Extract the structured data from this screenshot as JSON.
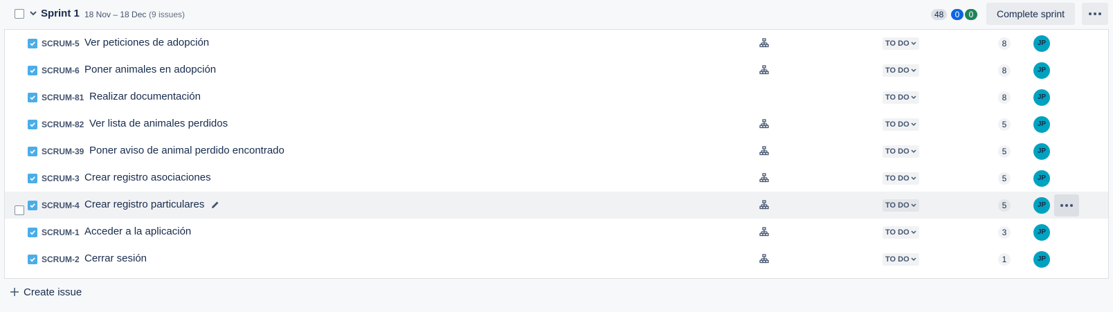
{
  "sprint": {
    "name": "Sprint 1",
    "dates": "18 Nov – 18 Dec",
    "issue_count": "(9 issues)",
    "points_total": "48",
    "points_in_progress": "0",
    "points_done": "0",
    "complete_label": "Complete sprint"
  },
  "issues": [
    {
      "key": "SCRUM-5",
      "summary": "Ver peticiones de adopción",
      "status": "TO DO",
      "points": "8",
      "assignee": "JP",
      "has_children": true
    },
    {
      "key": "SCRUM-6",
      "summary": "Poner animales en adopción",
      "status": "TO DO",
      "points": "8",
      "assignee": "JP",
      "has_children": true
    },
    {
      "key": "SCRUM-81",
      "summary": "Realizar documentación",
      "status": "TO DO",
      "points": "8",
      "assignee": "JP",
      "has_children": false
    },
    {
      "key": "SCRUM-82",
      "summary": "Ver lista de animales perdidos",
      "status": "TO DO",
      "points": "5",
      "assignee": "JP",
      "has_children": true
    },
    {
      "key": "SCRUM-39",
      "summary": "Poner aviso de animal perdido encontrado",
      "status": "TO DO",
      "points": "5",
      "assignee": "JP",
      "has_children": true
    },
    {
      "key": "SCRUM-3",
      "summary": "Crear registro asociaciones",
      "status": "TO DO",
      "points": "5",
      "assignee": "JP",
      "has_children": true
    },
    {
      "key": "SCRUM-4",
      "summary": "Crear registro particulares",
      "status": "TO DO",
      "points": "5",
      "assignee": "JP",
      "has_children": true,
      "hovered": true
    },
    {
      "key": "SCRUM-1",
      "summary": "Acceder a la aplicación",
      "status": "TO DO",
      "points": "3",
      "assignee": "JP",
      "has_children": true
    },
    {
      "key": "SCRUM-2",
      "summary": "Cerrar sesión",
      "status": "TO DO",
      "points": "1",
      "assignee": "JP",
      "has_children": true
    }
  ],
  "create_issue_label": "Create issue",
  "colors": {
    "story_type": "#4bade8",
    "avatar": "#00a3bf",
    "in_progress": "#0c66e4",
    "done": "#1f845a"
  }
}
